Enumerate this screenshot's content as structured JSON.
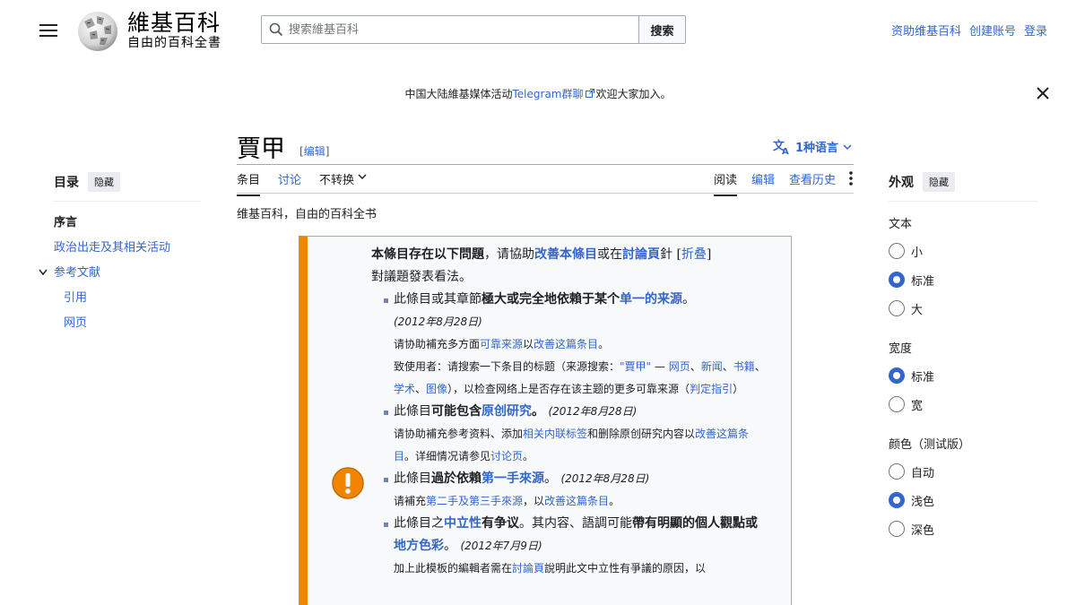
{
  "header": {
    "wordmark": "維基百科",
    "tagline": "自由的百科全書",
    "search_placeholder": "搜索維基百科",
    "search_button": "搜索",
    "user_links": [
      "资助维基百科",
      "创建账号",
      "登录"
    ]
  },
  "notice": {
    "text_before": "中国大陆維基媒体活动",
    "link": "Telegram群聊",
    "text_after": "欢迎大家加入。"
  },
  "article": {
    "title": "賈甲",
    "edit_label": "编辑",
    "language_button": "1种语言",
    "tabs_left": [
      "条目",
      "讨论",
      "不转换"
    ],
    "tabs_right": [
      "阅读",
      "编辑",
      "查看历史"
    ],
    "site_sub": "维基百科，自由的百科全书"
  },
  "toc": {
    "heading": "目录",
    "hide": "隐藏",
    "items": [
      "序言",
      "政治出走及其相关活动",
      "参考文献",
      "引用",
      "网页"
    ]
  },
  "appearance": {
    "heading": "外观",
    "hide": "隐藏",
    "text_label": "文本",
    "text_options": [
      "小",
      "标准",
      "大"
    ],
    "width_label": "宽度",
    "width_options": [
      "标准",
      "宽"
    ],
    "color_label": "颜色（测试版）",
    "color_options": [
      "自动",
      "浅色",
      "深色"
    ],
    "selected": {
      "text": "标准",
      "width": "标准",
      "color": "浅色"
    }
  },
  "ambox": {
    "intro_bold": "本條目存在以下問題",
    "intro_mid1": "，请協助",
    "intro_link1": "改善本條目",
    "intro_mid2": "或在",
    "intro_link2": "討論頁",
    "intro_mid3": "針",
    "collapse": "折叠",
    "intro_end": "對議題發表看法。",
    "i1_a": "此條目或其章節",
    "i1_b": "極大或完全地依賴于某个",
    "i1_link": "单一的来源",
    "i1_c": "。",
    "i1_date": "(2012年8月28日)",
    "i1_s1a": "请协助補充多方面",
    "i1_s1l1": "可靠来源",
    "i1_s1b": "以",
    "i1_s1l2": "改善这篇条目",
    "i1_s1c": "。",
    "i1_s2a": "致使用者：请搜索一下条目的标题（来源搜索：",
    "i1_s2l1": "\"賈甲\"",
    "i1_s2b": " — ",
    "i1_s2l2": "网页",
    "i1_s2c": "、",
    "i1_s2l3": "新闻",
    "i1_s2d": "、",
    "i1_s2l4": "书籍",
    "i1_s2e": "、",
    "i1_s2l5": "学术",
    "i1_s2f": "、",
    "i1_s2l6": "图像",
    "i1_s2g": "），以检查网络上是否存在该主题的更多可靠来源（",
    "i1_s2l7": "判定指引",
    "i1_s2h": "）",
    "i2_a": "此條目",
    "i2_b": "可能包含",
    "i2_link": "原创研究",
    "i2_c": "。",
    "i2_date": "(2012年8月28日)",
    "i2_s1a": "请协助補充参考资料、添加",
    "i2_s1l1": "相关内联标签",
    "i2_s1b": "和删除原创研究内容以",
    "i2_s1l2": "改善这篇条目",
    "i2_s1c": "。详细情况请参见",
    "i2_s1l3": "讨论页",
    "i2_s1d": "。",
    "i3_a": "此條目",
    "i3_b": "過於依賴",
    "i3_link": "第一手來源",
    "i3_c": "。",
    "i3_date": "(2012年8月28日)",
    "i3_s1a": "请補充",
    "i3_s1l1": "第二手及第三手來源",
    "i3_s1b": "，以",
    "i3_s1l2": "改善这篇条目",
    "i3_s1c": "。",
    "i4_a": "此條目之",
    "i4_link1": "中立性",
    "i4_b": "有争议",
    "i4_c": "。其内容、語調可能",
    "i4_d": "帶有明顯的個人觀點",
    "i4_e": "或",
    "i4_link2": "地方色彩",
    "i4_f": "。",
    "i4_date": "(2012年7月9日)",
    "i4_s1a": "加上此模板的編輯者需在",
    "i4_s1l1": "討論頁",
    "i4_s1b": "說明此文中立性有爭議的原因，以"
  },
  "colors": {
    "link": "#3366cc",
    "ambox_border": "#f28500",
    "icon": "#f28500"
  }
}
